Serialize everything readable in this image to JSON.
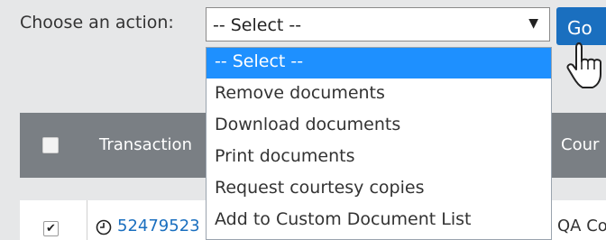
{
  "action_bar": {
    "label": "Choose an action:",
    "select_value": "-- Select --",
    "go_label": "Go"
  },
  "dropdown": {
    "options": [
      "-- Select --",
      "Remove documents",
      "Download documents",
      "Print documents",
      "Request courtesy copies",
      "Add to Custom Document List"
    ],
    "selected_index": 0
  },
  "table": {
    "headers": {
      "transaction": "Transaction",
      "court": "Cour"
    },
    "rows": [
      {
        "checked": true,
        "transaction_id": "52479523",
        "court": "QA Co"
      }
    ]
  },
  "colors": {
    "accent": "#1a6fbf",
    "header_bg": "#7a7f84",
    "selected_option_bg": "#1e90ff",
    "page_bg": "#e6e7e8"
  },
  "icons": [
    "dropdown-arrow-icon",
    "hand-pointer-icon",
    "clock-icon",
    "checkbox-icon"
  ]
}
